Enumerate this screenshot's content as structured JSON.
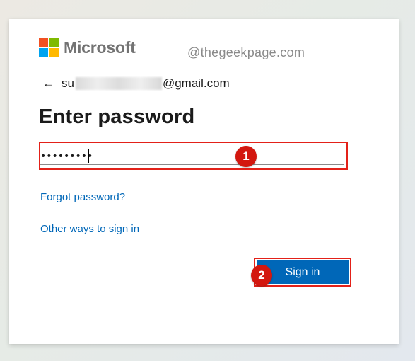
{
  "brand": {
    "name": "Microsoft",
    "logo_colors": [
      "#f25022",
      "#7fba00",
      "#00a4ef",
      "#ffb900"
    ]
  },
  "watermark": "@thegeekpage.com",
  "account": {
    "back_icon": "arrow-left-icon",
    "email_visible_prefix": "su",
    "email_suffix": "@gmail.com"
  },
  "title": "Enter password",
  "password_field": {
    "value": "•••••••••"
  },
  "links": {
    "forgot_password": "Forgot password?",
    "other_ways": "Other ways to sign in"
  },
  "signin_button": {
    "label": "Sign in"
  },
  "annotations": [
    {
      "label": "1",
      "color": "#d3170f"
    },
    {
      "label": "2",
      "color": "#d3170f"
    }
  ],
  "colors": {
    "accent": "#0067b8",
    "highlight": "#e32119"
  }
}
